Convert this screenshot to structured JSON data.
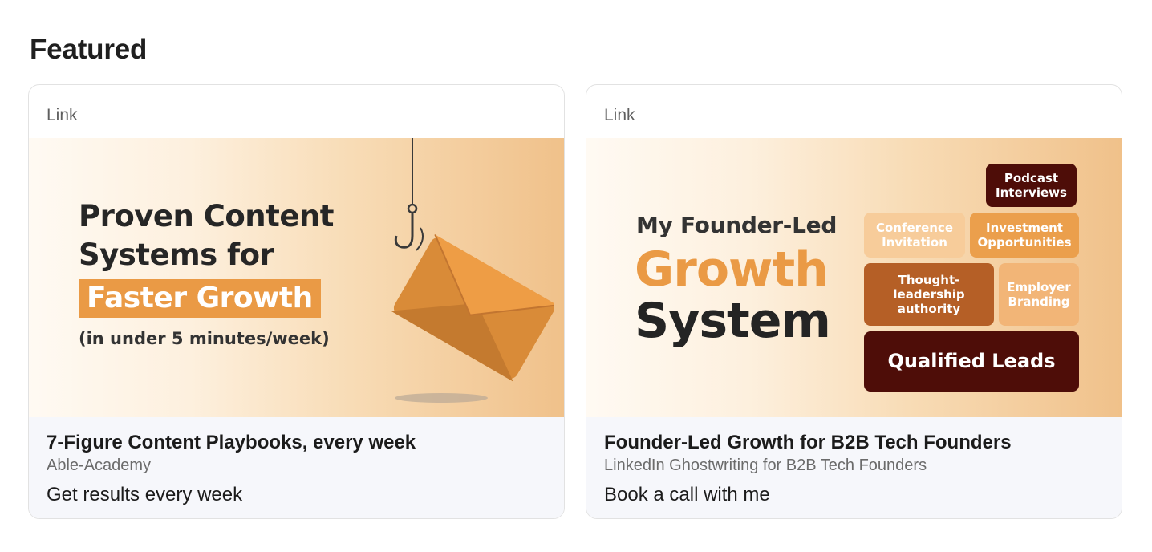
{
  "section": {
    "title": "Featured"
  },
  "cards": [
    {
      "type_label": "Link",
      "banner": {
        "line1": "Proven Content",
        "line2": "Systems for",
        "highlight": "Faster Growth",
        "small": "(in under 5 minutes/week)"
      },
      "title": "7-Figure Content Playbooks, every week",
      "subtitle": "Able-Academy",
      "cta": "Get results every week"
    },
    {
      "type_label": "Link",
      "banner": {
        "top": "My Founder-Led",
        "big1": "Growth",
        "big2": "System",
        "tiles": {
          "podcast": "Podcast Interviews",
          "conference": "Conference Invitation",
          "investment": "Investment Opportunities",
          "thought": "Thought-leadership authority",
          "employer": "Employer Branding",
          "leads": "Qualified Leads"
        }
      },
      "title": "Founder-Led Growth for B2B Tech Founders",
      "subtitle": "LinkedIn Ghostwriting for B2B Tech Founders",
      "cta": "Book a call with me"
    }
  ],
  "colors": {
    "accent_orange": "#ea9a45",
    "dark_maroon": "#4e0d08",
    "rust": "#b55f26",
    "card_footer_bg": "#f6f7fb"
  },
  "icons": {
    "banner1": "hooked-envelope-icon"
  }
}
